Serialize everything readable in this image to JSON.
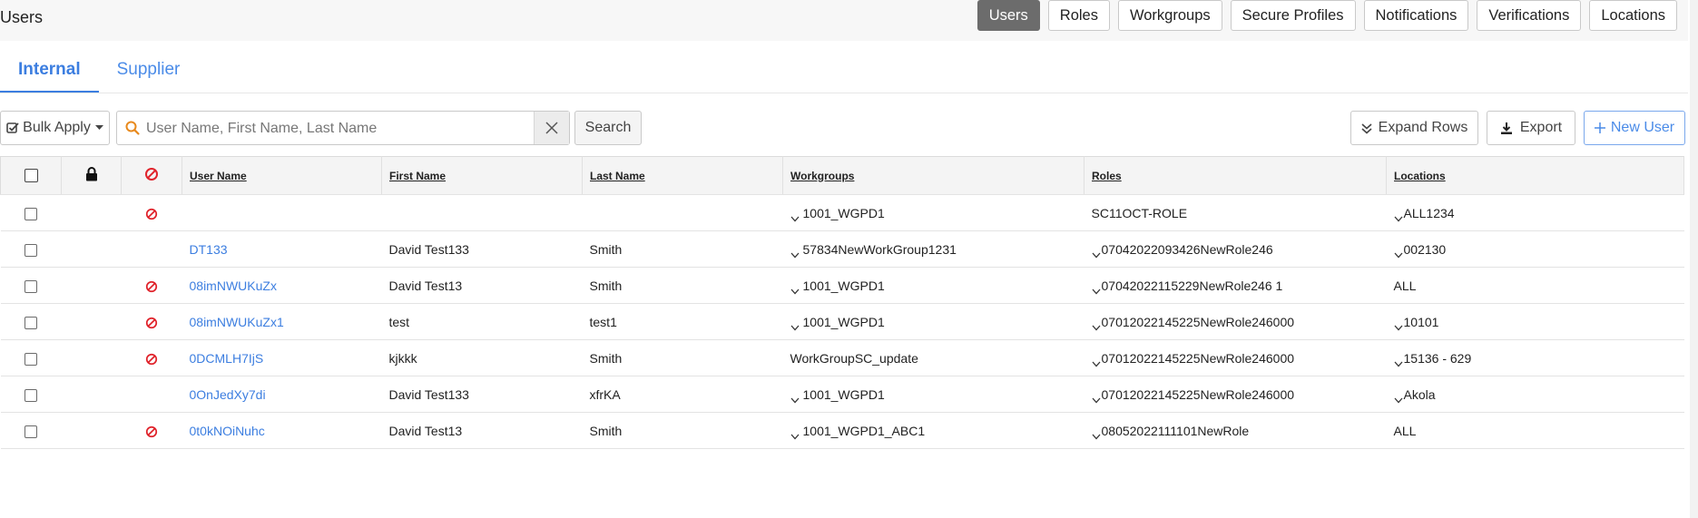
{
  "header": {
    "title": "Users",
    "tabs": [
      {
        "label": "Users",
        "active": true
      },
      {
        "label": "Roles",
        "active": false
      },
      {
        "label": "Workgroups",
        "active": false
      },
      {
        "label": "Secure Profiles",
        "active": false
      },
      {
        "label": "Notifications",
        "active": false
      },
      {
        "label": "Verifications",
        "active": false
      },
      {
        "label": "Locations",
        "active": false
      }
    ]
  },
  "subtabs": [
    {
      "label": "Internal",
      "active": true
    },
    {
      "label": "Supplier",
      "active": false
    }
  ],
  "toolbar": {
    "bulk_apply_label": "Bulk Apply",
    "search_placeholder": "User Name, First Name, Last Name",
    "search_value": "",
    "search_button_label": "Search",
    "expand_rows_label": "Expand Rows",
    "export_label": "Export",
    "new_user_label": "New User"
  },
  "table": {
    "columns": [
      "User Name",
      "First Name",
      "Last Name",
      "Workgroups",
      "Roles",
      "Locations"
    ],
    "rows": [
      {
        "username": "",
        "first": "",
        "last": "",
        "workgroup": "1001_WGPD1",
        "wg_expand": true,
        "role": "SC11OCT-ROLE",
        "role_expand": false,
        "location": "ALL1234",
        "loc_expand": true,
        "disabled": true
      },
      {
        "username": "DT133",
        "first": "David Test133",
        "last": "Smith",
        "workgroup": "57834NewWorkGroup1231",
        "wg_expand": true,
        "role": "07042022093426NewRole246",
        "role_expand": true,
        "location": "002130",
        "loc_expand": true,
        "disabled": false
      },
      {
        "username": "08imNWUKuZx",
        "first": "David Test13",
        "last": "Smith",
        "workgroup": "1001_WGPD1",
        "wg_expand": true,
        "role": "07042022115229NewRole246 1",
        "role_expand": true,
        "location": "ALL",
        "loc_expand": false,
        "disabled": true
      },
      {
        "username": "08imNWUKuZx1",
        "first": "test",
        "last": "test1",
        "workgroup": "1001_WGPD1",
        "wg_expand": true,
        "role": "07012022145225NewRole246000",
        "role_expand": true,
        "location": "10101",
        "loc_expand": true,
        "disabled": true
      },
      {
        "username": "0DCMLH7IjS",
        "first": "kjkkk",
        "last": "Smith",
        "workgroup": "WorkGroupSC_update",
        "wg_expand": false,
        "role": "07012022145225NewRole246000",
        "role_expand": true,
        "location": "15136 - 629",
        "loc_expand": true,
        "disabled": true
      },
      {
        "username": "0OnJedXy7di",
        "first": "David Test133",
        "last": "xfrKA",
        "workgroup": "1001_WGPD1",
        "wg_expand": true,
        "role": "07012022145225NewRole246000",
        "role_expand": true,
        "location": "Akola",
        "loc_expand": true,
        "disabled": false
      },
      {
        "username": "0t0kNOiNuhc",
        "first": "David Test13",
        "last": "Smith",
        "workgroup": "1001_WGPD1_ABC1",
        "wg_expand": true,
        "role": "08052022111101NewRole",
        "role_expand": true,
        "location": "ALL",
        "loc_expand": false,
        "disabled": true
      }
    ]
  },
  "colors": {
    "accent": "#3c7ee0",
    "active_tab": "#6c6c6c",
    "disabled_icon": "#e0232b"
  },
  "icons": {
    "lock": "lock-icon",
    "disabled": "no-entry-icon",
    "search": "search-icon",
    "clear": "close-icon",
    "expand": "chevron-down-icon",
    "export": "download-icon",
    "new": "plus-icon",
    "bulk": "checkbox-icon"
  }
}
